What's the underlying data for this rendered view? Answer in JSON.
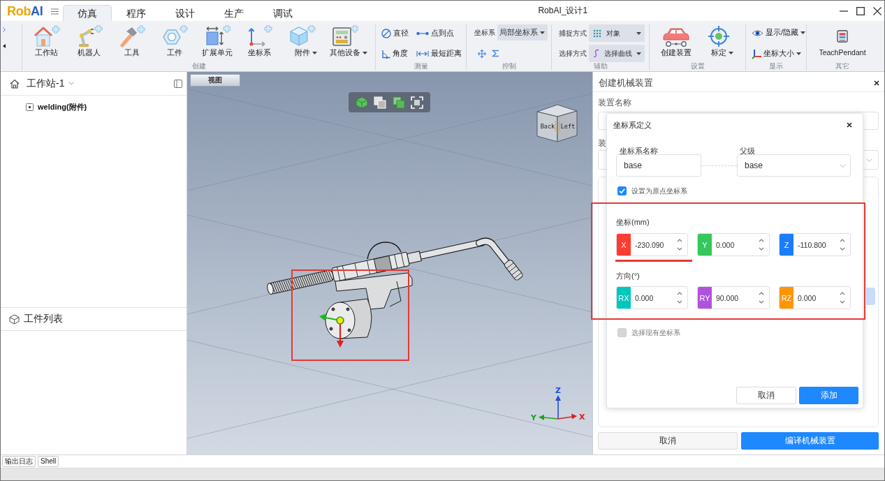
{
  "logo": [
    {
      "text": "Rob",
      "color": "#f2a300"
    },
    {
      "text": "AI",
      "color": "#2a62c8"
    }
  ],
  "menu_tabs": [
    {
      "label": "仿真",
      "selected": true
    },
    {
      "label": "程序",
      "selected": false
    },
    {
      "label": "设计",
      "selected": false
    },
    {
      "label": "生产",
      "selected": false
    },
    {
      "label": "调试",
      "selected": false
    }
  ],
  "window": {
    "title": "RobAI_设计1"
  },
  "ribbon": {
    "groups": [
      {
        "label": "创建",
        "kind": "large",
        "items": [
          {
            "label": "工作站",
            "dropdown": false
          },
          {
            "label": "机器人",
            "dropdown": false
          },
          {
            "label": "工具",
            "dropdown": false
          },
          {
            "label": "工件",
            "dropdown": false
          },
          {
            "label": "扩展单元",
            "dropdown": false
          },
          {
            "label": "坐标系",
            "dropdown": false
          },
          {
            "label": "附件",
            "dropdown": true
          },
          {
            "label": "其他设备",
            "dropdown": true
          }
        ]
      },
      {
        "label": "测量",
        "kind": "tools",
        "items": [
          {
            "label": "直径"
          },
          {
            "label": "点到点"
          },
          {
            "label": "角度"
          },
          {
            "label": "最短距离"
          }
        ]
      },
      {
        "label": "控制",
        "kind": "control",
        "field_label": "坐标系",
        "value": "局部坐标系"
      },
      {
        "label": "辅助",
        "kind": "selects",
        "rows": [
          {
            "label": "捕捉方式",
            "value": "对象"
          },
          {
            "label": "选择方式",
            "value": "选择曲线"
          }
        ]
      },
      {
        "label": "设置",
        "kind": "large",
        "items": [
          {
            "label": "创建装置",
            "dropdown": false
          },
          {
            "label": "标定",
            "dropdown": true
          }
        ]
      },
      {
        "label": "显示",
        "kind": "menus",
        "items": [
          {
            "label": "显示/隐藏",
            "dropdown": true
          },
          {
            "label": "坐标大小",
            "dropdown": true
          }
        ]
      },
      {
        "label": "其它",
        "kind": "large",
        "items": [
          {
            "label": "TeachPendant",
            "dropdown": false
          }
        ]
      }
    ]
  },
  "station_panel": {
    "title": "工作站-1",
    "tree": [
      {
        "label": "welding(附件)"
      }
    ]
  },
  "parts_panel": {
    "title": "工件列表"
  },
  "viewport": {
    "tab": "视图",
    "view_cube": {
      "faces": [
        "Back",
        "Left"
      ]
    },
    "axis_labels": [
      {
        "text": "Z",
        "color": "#1f4fd8"
      },
      {
        "text": "Y",
        "color": "#22a022"
      },
      {
        "text": "X",
        "color": "#d92020"
      }
    ]
  },
  "mechanism_panel": {
    "title": "创建机械装置",
    "name_label": "装置名称",
    "type_label": "装",
    "buttons": [
      {
        "label": "取消",
        "kind": "secondary"
      },
      {
        "label": "编译机械装置",
        "kind": "primary"
      }
    ]
  },
  "frame_dialog": {
    "title": "坐标系定义",
    "name_label": "坐标系名称",
    "name_value": "base",
    "parent_label": "父级",
    "parent_value": "base",
    "origin_checkbox": {
      "label": "设置为原点坐标系",
      "checked": true,
      "disabled": false
    },
    "position": {
      "label": "坐标(mm)",
      "fields": [
        {
          "axis": "X",
          "value": "-230.090",
          "color": "#ff3b30"
        },
        {
          "axis": "Y",
          "value": "0.000",
          "color": "#34c759"
        },
        {
          "axis": "Z",
          "value": "-110.800",
          "color": "#1a7cff"
        }
      ]
    },
    "orientation": {
      "label": "方向(°)",
      "fields": [
        {
          "axis": "RX",
          "value": "0.000",
          "color": "#00c7be"
        },
        {
          "axis": "RY",
          "value": "90.000",
          "color": "#af52de"
        },
        {
          "axis": "RZ",
          "value": "0.000",
          "color": "#ff9500"
        }
      ]
    },
    "existing_checkbox": {
      "label": "选择现有坐标系",
      "checked": false,
      "disabled": true
    },
    "buttons": [
      {
        "label": "取消",
        "kind": "secondary"
      },
      {
        "label": "添加",
        "kind": "primary"
      }
    ]
  },
  "bottom_tabs": [
    {
      "label": "输出日志"
    },
    {
      "label": "Shell"
    }
  ]
}
